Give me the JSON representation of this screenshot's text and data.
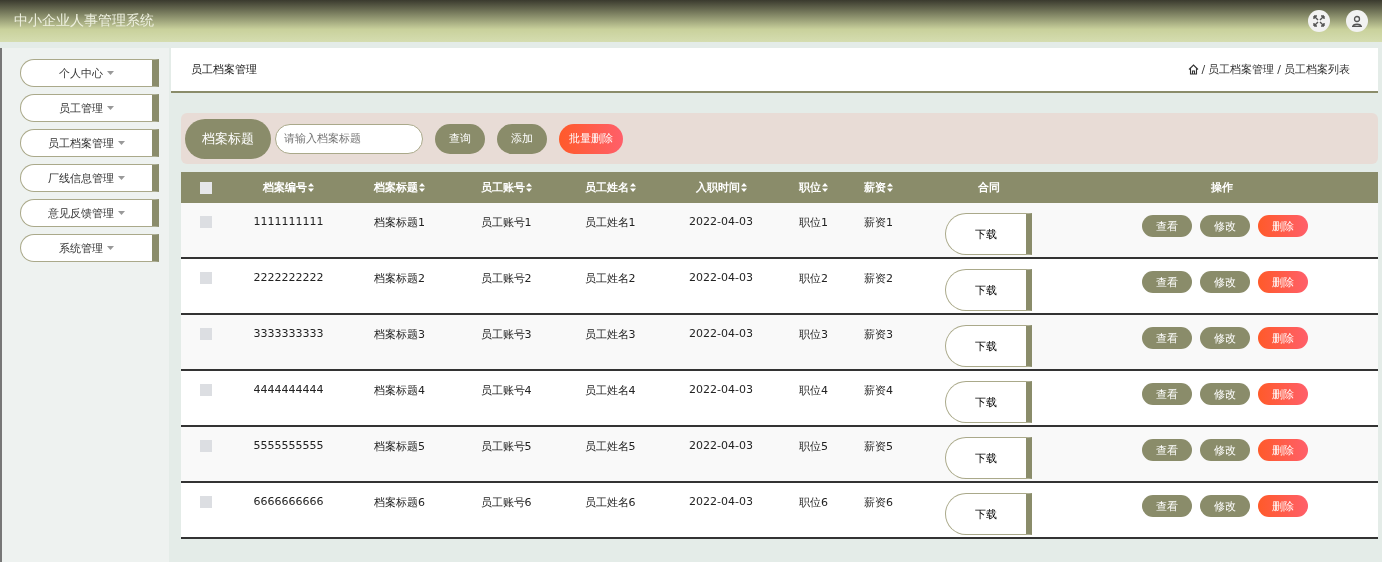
{
  "header": {
    "title": "中小企业人事管理系统"
  },
  "sidebar": {
    "items": [
      {
        "label": "个人中心"
      },
      {
        "label": "员工管理"
      },
      {
        "label": "员工档案管理"
      },
      {
        "label": "厂线信息管理"
      },
      {
        "label": "意见反馈管理"
      },
      {
        "label": "系统管理"
      }
    ]
  },
  "page": {
    "title": "员工档案管理",
    "breadcrumb_separator": "/",
    "breadcrumb": [
      "员工档案管理",
      "员工档案列表"
    ]
  },
  "search": {
    "label": "档案标题",
    "placeholder": "请输入档案标题",
    "buttons": [
      {
        "label": "查询",
        "kind": "normal"
      },
      {
        "label": "添加",
        "kind": "normal"
      },
      {
        "label": "批量删除",
        "kind": "danger"
      }
    ]
  },
  "table": {
    "select_all_checked": false,
    "columns": [
      {
        "label": "档案编号",
        "sortable": true
      },
      {
        "label": "档案标题",
        "sortable": true
      },
      {
        "label": "员工账号",
        "sortable": true
      },
      {
        "label": "员工姓名",
        "sortable": true
      },
      {
        "label": "入职时间",
        "sortable": true
      },
      {
        "label": "职位",
        "sortable": true
      },
      {
        "label": "薪资",
        "sortable": true
      },
      {
        "label": "合同",
        "sortable": false
      },
      {
        "label": "操作",
        "sortable": false
      }
    ],
    "rows": [
      {
        "checked": false,
        "cells": [
          "1111111111",
          "档案标题1",
          "员工账号1",
          "员工姓名1",
          "2022-04-03",
          "职位1",
          "薪资1"
        ],
        "contract": "下载",
        "actions": [
          {
            "label": "查看",
            "kind": "normal"
          },
          {
            "label": "修改",
            "kind": "normal"
          },
          {
            "label": "删除",
            "kind": "danger"
          }
        ]
      },
      {
        "checked": false,
        "cells": [
          "2222222222",
          "档案标题2",
          "员工账号2",
          "员工姓名2",
          "2022-04-03",
          "职位2",
          "薪资2"
        ],
        "contract": "下载",
        "actions": [
          {
            "label": "查看",
            "kind": "normal"
          },
          {
            "label": "修改",
            "kind": "normal"
          },
          {
            "label": "删除",
            "kind": "danger"
          }
        ]
      },
      {
        "checked": false,
        "cells": [
          "3333333333",
          "档案标题3",
          "员工账号3",
          "员工姓名3",
          "2022-04-03",
          "职位3",
          "薪资3"
        ],
        "contract": "下载",
        "actions": [
          {
            "label": "查看",
            "kind": "normal"
          },
          {
            "label": "修改",
            "kind": "normal"
          },
          {
            "label": "删除",
            "kind": "danger"
          }
        ]
      },
      {
        "checked": false,
        "cells": [
          "4444444444",
          "档案标题4",
          "员工账号4",
          "员工姓名4",
          "2022-04-03",
          "职位4",
          "薪资4"
        ],
        "contract": "下载",
        "actions": [
          {
            "label": "查看",
            "kind": "normal"
          },
          {
            "label": "修改",
            "kind": "normal"
          },
          {
            "label": "删除",
            "kind": "danger"
          }
        ]
      },
      {
        "checked": false,
        "cells": [
          "5555555555",
          "档案标题5",
          "员工账号5",
          "员工姓名5",
          "2022-04-03",
          "职位5",
          "薪资5"
        ],
        "contract": "下载",
        "actions": [
          {
            "label": "查看",
            "kind": "normal"
          },
          {
            "label": "修改",
            "kind": "normal"
          },
          {
            "label": "删除",
            "kind": "danger"
          }
        ]
      },
      {
        "checked": false,
        "cells": [
          "6666666666",
          "档案标题6",
          "员工账号6",
          "员工姓名6",
          "2022-04-03",
          "职位6",
          "薪资6"
        ],
        "contract": "下载",
        "actions": [
          {
            "label": "查看",
            "kind": "normal"
          },
          {
            "label": "修改",
            "kind": "normal"
          },
          {
            "label": "删除",
            "kind": "danger"
          }
        ]
      }
    ]
  }
}
